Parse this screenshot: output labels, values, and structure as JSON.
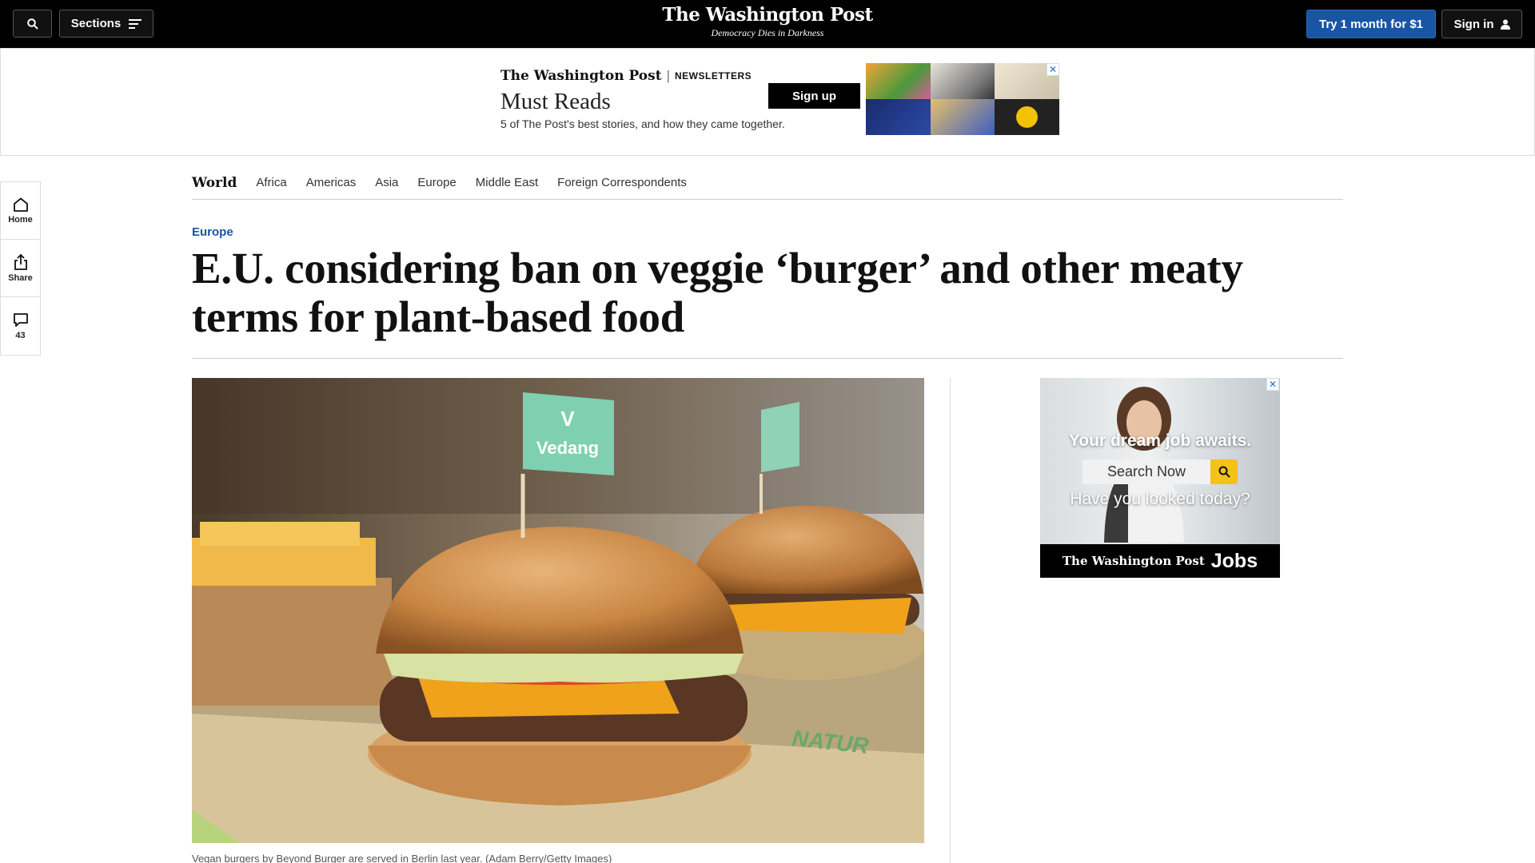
{
  "topbar": {
    "sections_label": "Sections",
    "logo": "The Washington Post",
    "tagline": "Democracy Dies in Darkness",
    "try_label": "Try 1 month for $1",
    "signin_label": "Sign in"
  },
  "newsletter_ad": {
    "brand": "The Washington Post",
    "newsletters": "NEWSLETTERS",
    "title": "Must Reads",
    "description": "5 of The Post's best stories, and how they came together.",
    "signup_label": "Sign up",
    "close": "✕"
  },
  "rail": {
    "home": "Home",
    "share": "Share",
    "comments": "43"
  },
  "section_nav": {
    "world": "World",
    "items": [
      "Africa",
      "Americas",
      "Asia",
      "Europe",
      "Middle East",
      "Foreign Correspondents"
    ]
  },
  "article": {
    "kicker": "Europe",
    "headline": "E.U. considering ban on veggie ‘burger’ and other meaty terms for plant-based food",
    "caption": "Vegan burgers by Beyond Burger are served in Berlin last year. (Adam Berry/Getty Images)",
    "photo_flag_text": "Vedang",
    "photo_flag_letter": "V",
    "photo_paper_text": "NATUR"
  },
  "jobs_ad": {
    "dream": "Your dream job awaits.",
    "search_placeholder": "Search Now",
    "look": "Have you looked today?",
    "brand": "The Washington Post",
    "jobs": "Jobs",
    "close": "✕"
  },
  "colors": {
    "accent_blue": "#1955a5",
    "topbar_bg": "#000000",
    "jobs_yellow": "#f3c21b"
  }
}
